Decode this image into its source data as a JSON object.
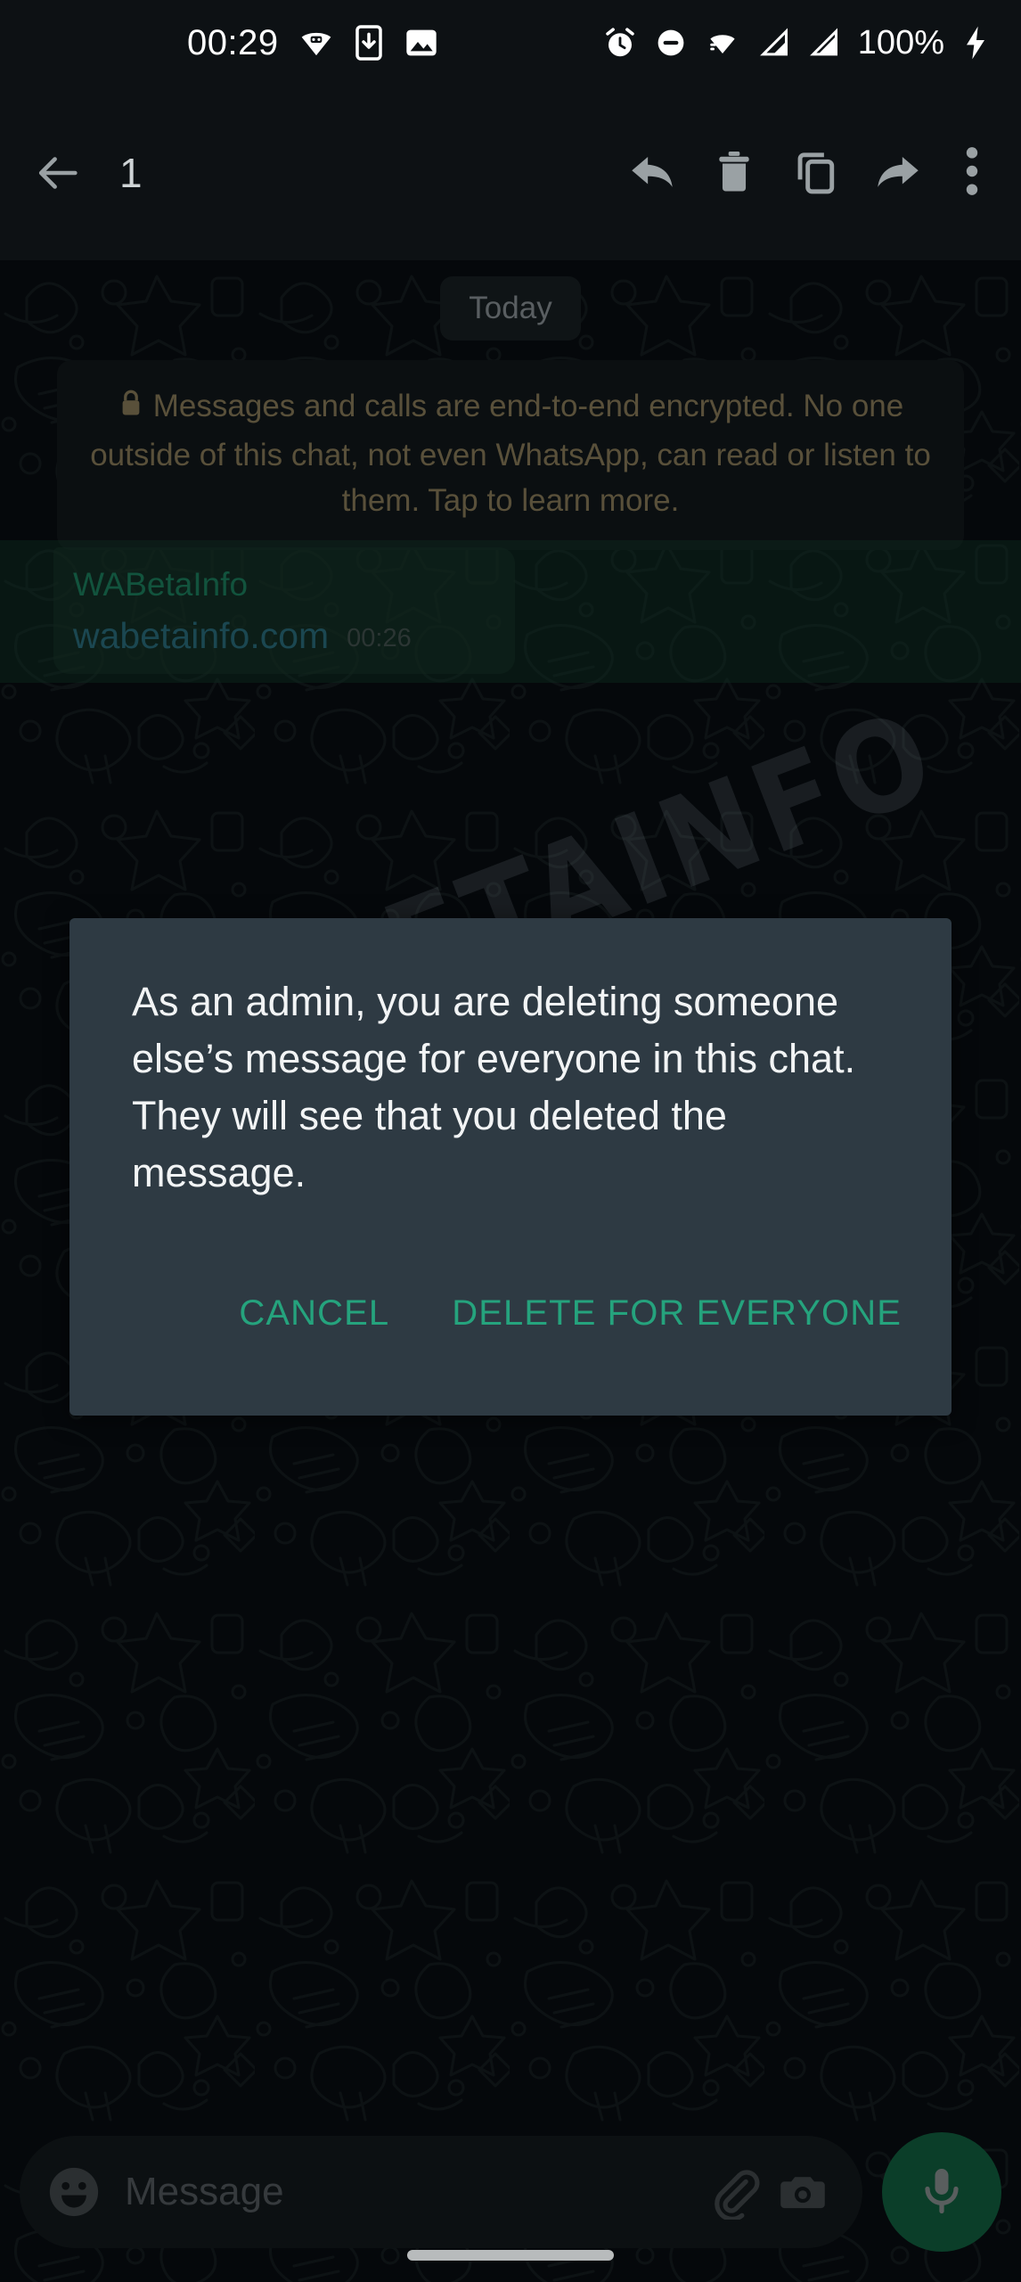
{
  "statusbar": {
    "time": "00:29",
    "battery": "100%",
    "left_icons": [
      {
        "name": "android-beam-icon"
      },
      {
        "name": "phone-download-icon"
      },
      {
        "name": "image-icon"
      }
    ],
    "right_icons": [
      {
        "name": "alarm-icon"
      },
      {
        "name": "do-not-disturb-icon"
      },
      {
        "name": "wifi-icon"
      },
      {
        "name": "signal-bars-icon"
      },
      {
        "name": "signal-bars-2-icon"
      },
      {
        "name": "charging-bolt-icon"
      }
    ]
  },
  "toolbar": {
    "back_label": "back",
    "selected_count": "1",
    "actions": [
      {
        "name": "reply-icon",
        "label": "Reply"
      },
      {
        "name": "delete-icon",
        "label": "Delete"
      },
      {
        "name": "copy-icon",
        "label": "Copy"
      },
      {
        "name": "forward-icon",
        "label": "Forward"
      },
      {
        "name": "overflow-menu-icon",
        "label": "More options"
      }
    ]
  },
  "chat": {
    "date_chip": "Today",
    "encryption_notice": "Messages and calls are end-to-end encrypted. No one outside of this chat, not even WhatsApp, can read or listen to them. Tap to learn more.",
    "message": {
      "sender": "WABetaInfo",
      "text": "wabetainfo.com",
      "time": "00:26",
      "selected": true
    }
  },
  "watermark": {
    "text": "WABETAINFO"
  },
  "dialog": {
    "body": "As an admin, you are deleting someone else’s message for everyone in this chat. They will see that you deleted the message.",
    "cancel_label": "CANCEL",
    "confirm_label": "DELETE FOR EVERYONE"
  },
  "composer": {
    "placeholder": "Message",
    "emoji_icon": "emoji-icon",
    "attach_icon": "attach-paperclip-icon",
    "camera_icon": "camera-icon",
    "mic_icon": "microphone-icon"
  },
  "colors": {
    "accent_green": "#25a37d",
    "mic_green": "#146c47",
    "dialog_bg": "#2e3a43",
    "sender_green": "#1f8f6a",
    "link_blue": "#2f7a8c",
    "encrypt_gold": "#9a8b64",
    "chat_bg": "#0a0f13"
  }
}
